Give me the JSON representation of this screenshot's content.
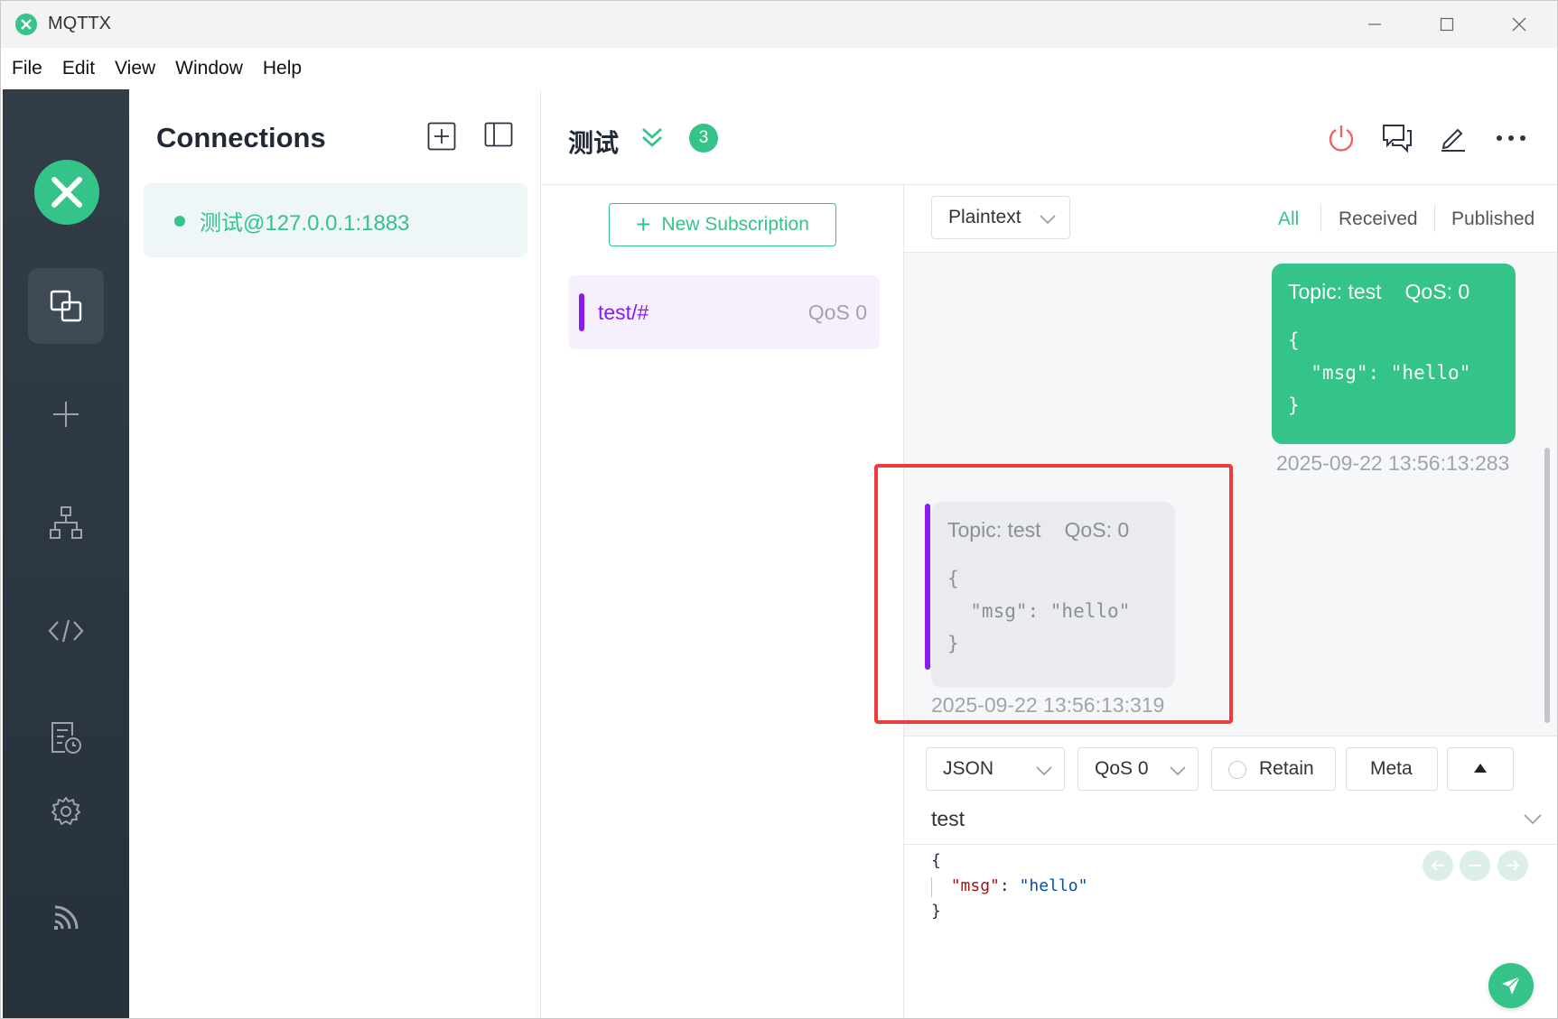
{
  "window": {
    "title": "MQTTX"
  },
  "menu": [
    "File",
    "Edit",
    "View",
    "Window",
    "Help"
  ],
  "connections": {
    "title": "Connections",
    "items": [
      {
        "name": "测试@127.0.0.1:1883",
        "status": "connected"
      }
    ]
  },
  "main": {
    "title": "测试",
    "badge": "3"
  },
  "subscriptions": {
    "new_button": "New Subscription",
    "items": [
      {
        "topic": "test/#",
        "qos": "QoS 0",
        "color": "#8a1bea"
      }
    ]
  },
  "messages": {
    "format": "Plaintext",
    "tabs": {
      "all": "All",
      "received": "Received",
      "published": "Published"
    },
    "published": {
      "topic": "Topic: test",
      "qos": "QoS: 0",
      "payload": "{\n  \"msg\": \"hello\"\n}",
      "time": "2025-09-22 13:56:13:283"
    },
    "received": {
      "topic": "Topic: test",
      "qos": "QoS: 0",
      "payload": "{\n  \"msg\": \"hello\"\n}",
      "time": "2025-09-22 13:56:13:319"
    }
  },
  "publish": {
    "format": "JSON",
    "qos": "QoS 0",
    "retain_label": "Retain",
    "meta_label": "Meta",
    "topic": "test",
    "payload": {
      "open": "{",
      "key": "\"msg\"",
      "colon": ": ",
      "value": "\"hello\"",
      "close": "}"
    }
  },
  "colors": {
    "accent": "#34c388",
    "subscription": "#8a1bea",
    "highlight": "#ef3b3b",
    "nav_bg": "#2e3843"
  }
}
